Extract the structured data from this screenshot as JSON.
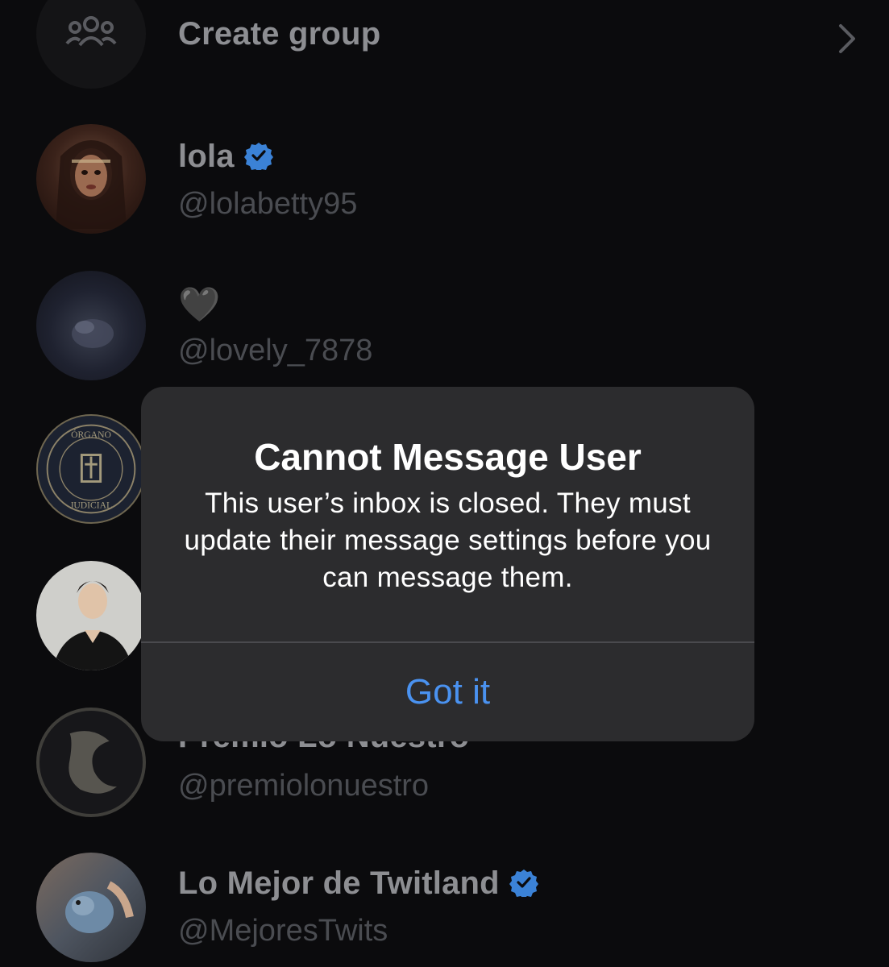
{
  "create_group": {
    "label": "Create group",
    "icon": "group-icon",
    "chevron": "chevron-right-icon"
  },
  "contacts": [
    {
      "name": "lola",
      "handle": "@lolabetty95",
      "verified": true
    },
    {
      "name": "🖤",
      "handle": "@lovely_7878",
      "verified": false
    },
    {
      "name": "",
      "handle": "",
      "verified": false
    },
    {
      "name": "",
      "handle": "",
      "verified": false
    },
    {
      "name": "Premio Lo Nuestro",
      "handle": "@premiolonuestro",
      "verified": true
    },
    {
      "name": "Lo Mejor de Twitland",
      "handle": "@MejoresTwits",
      "verified": true
    }
  ],
  "alert": {
    "title": "Cannot Message User",
    "message": "This user’s inbox is closed. They must update their message settings before you can message them.",
    "button": "Got it"
  },
  "colors": {
    "background": "#0b0b0d",
    "alert_bg": "#2c2c2e",
    "accent": "#4a92f0",
    "verified": "#3b82d6"
  }
}
